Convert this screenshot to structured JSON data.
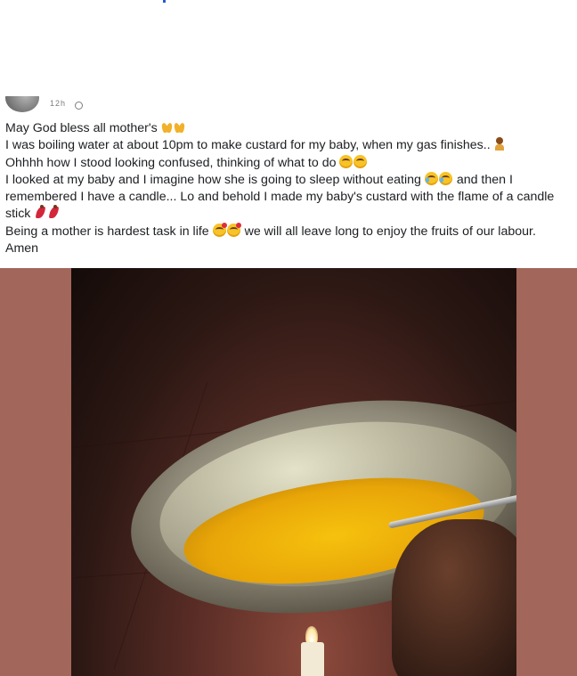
{
  "post": {
    "time": "12h",
    "lines": [
      "May God bless all mother's",
      "I was boiling water at about 10pm  to make custard for my baby, when my gas finishes..",
      "Ohhhh how I stood looking confused, thinking of what to do",
      "I looked at my baby and I imagine how she is going to sleep without eating",
      "and then I",
      "remembered I have a candle... Lo and behold I made my baby's custard with the flame of a candle",
      "stick",
      "Being a mother is hardest task in life",
      "we will all leave long to enjoy the fruits of our labour.",
      "Amen"
    ],
    "emoji": [
      "folded-hands",
      "woman-shrugging",
      "sad-face",
      "crying-face",
      "kissing-face",
      "dancer"
    ]
  },
  "colors": {
    "photo_band": "#a3665a",
    "custard": "#f6c20e",
    "text": "#1c1e21"
  }
}
